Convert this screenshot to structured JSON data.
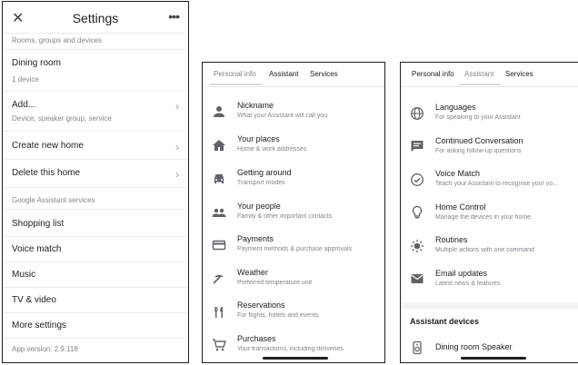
{
  "screen1": {
    "title": "Settings",
    "rooms_caption": "Rooms, groups and devices",
    "dining_room": "Dining room",
    "dining_room_count": "1 device",
    "add_label": "Add...",
    "add_sub": "Device, speaker group, service",
    "create_home": "Create new home",
    "delete_home": "Delete this home",
    "services_caption": "Google Assistant services",
    "shopping_list": "Shopping list",
    "voice_match": "Voice match",
    "music": "Music",
    "tv_video": "TV & video",
    "more_settings": "More settings",
    "app_version": "App version: 2.9.118"
  },
  "screen2": {
    "tabs": [
      "Personal info",
      "Assistant",
      "Services"
    ],
    "items": [
      {
        "title": "Nickname",
        "subtitle": "What your Assistant will call you",
        "icon": "person-icon"
      },
      {
        "title": "Your places",
        "subtitle": "Home & work addresses",
        "icon": "home-icon"
      },
      {
        "title": "Getting around",
        "subtitle": "Transport modes",
        "icon": "car-icon"
      },
      {
        "title": "Your people",
        "subtitle": "Family & other important contacts",
        "icon": "people-icon"
      },
      {
        "title": "Payments",
        "subtitle": "Payment methods & purchase approvals",
        "icon": "card-icon"
      },
      {
        "title": "Weather",
        "subtitle": "Preferred temperature unit",
        "icon": "weather-icon"
      },
      {
        "title": "Reservations",
        "subtitle": "For flights, hotels and events",
        "icon": "restaurant-icon"
      },
      {
        "title": "Purchases",
        "subtitle": "Your transactions, including deliveries",
        "icon": "cart-icon"
      }
    ]
  },
  "screen3": {
    "tabs": [
      "Personal info",
      "Assistant",
      "Services"
    ],
    "items": [
      {
        "title": "Languages",
        "subtitle": "For speaking to your Assistant",
        "icon": "globe-icon"
      },
      {
        "title": "Continued Conversation",
        "subtitle": "For asking follow-up questions",
        "icon": "chat-icon"
      },
      {
        "title": "Voice Match",
        "subtitle": "Teach your Assistant to recognise your vo...",
        "icon": "voice-match-icon"
      },
      {
        "title": "Home Control",
        "subtitle": "Manage the devices in your home",
        "icon": "lightbulb-icon"
      },
      {
        "title": "Routines",
        "subtitle": "Multiple actions with one command",
        "icon": "routines-icon"
      },
      {
        "title": "Email updates",
        "subtitle": "Latest news & features",
        "icon": "mail-icon"
      }
    ],
    "devices_header": "Assistant devices",
    "device_name": "Dining room Speaker"
  }
}
